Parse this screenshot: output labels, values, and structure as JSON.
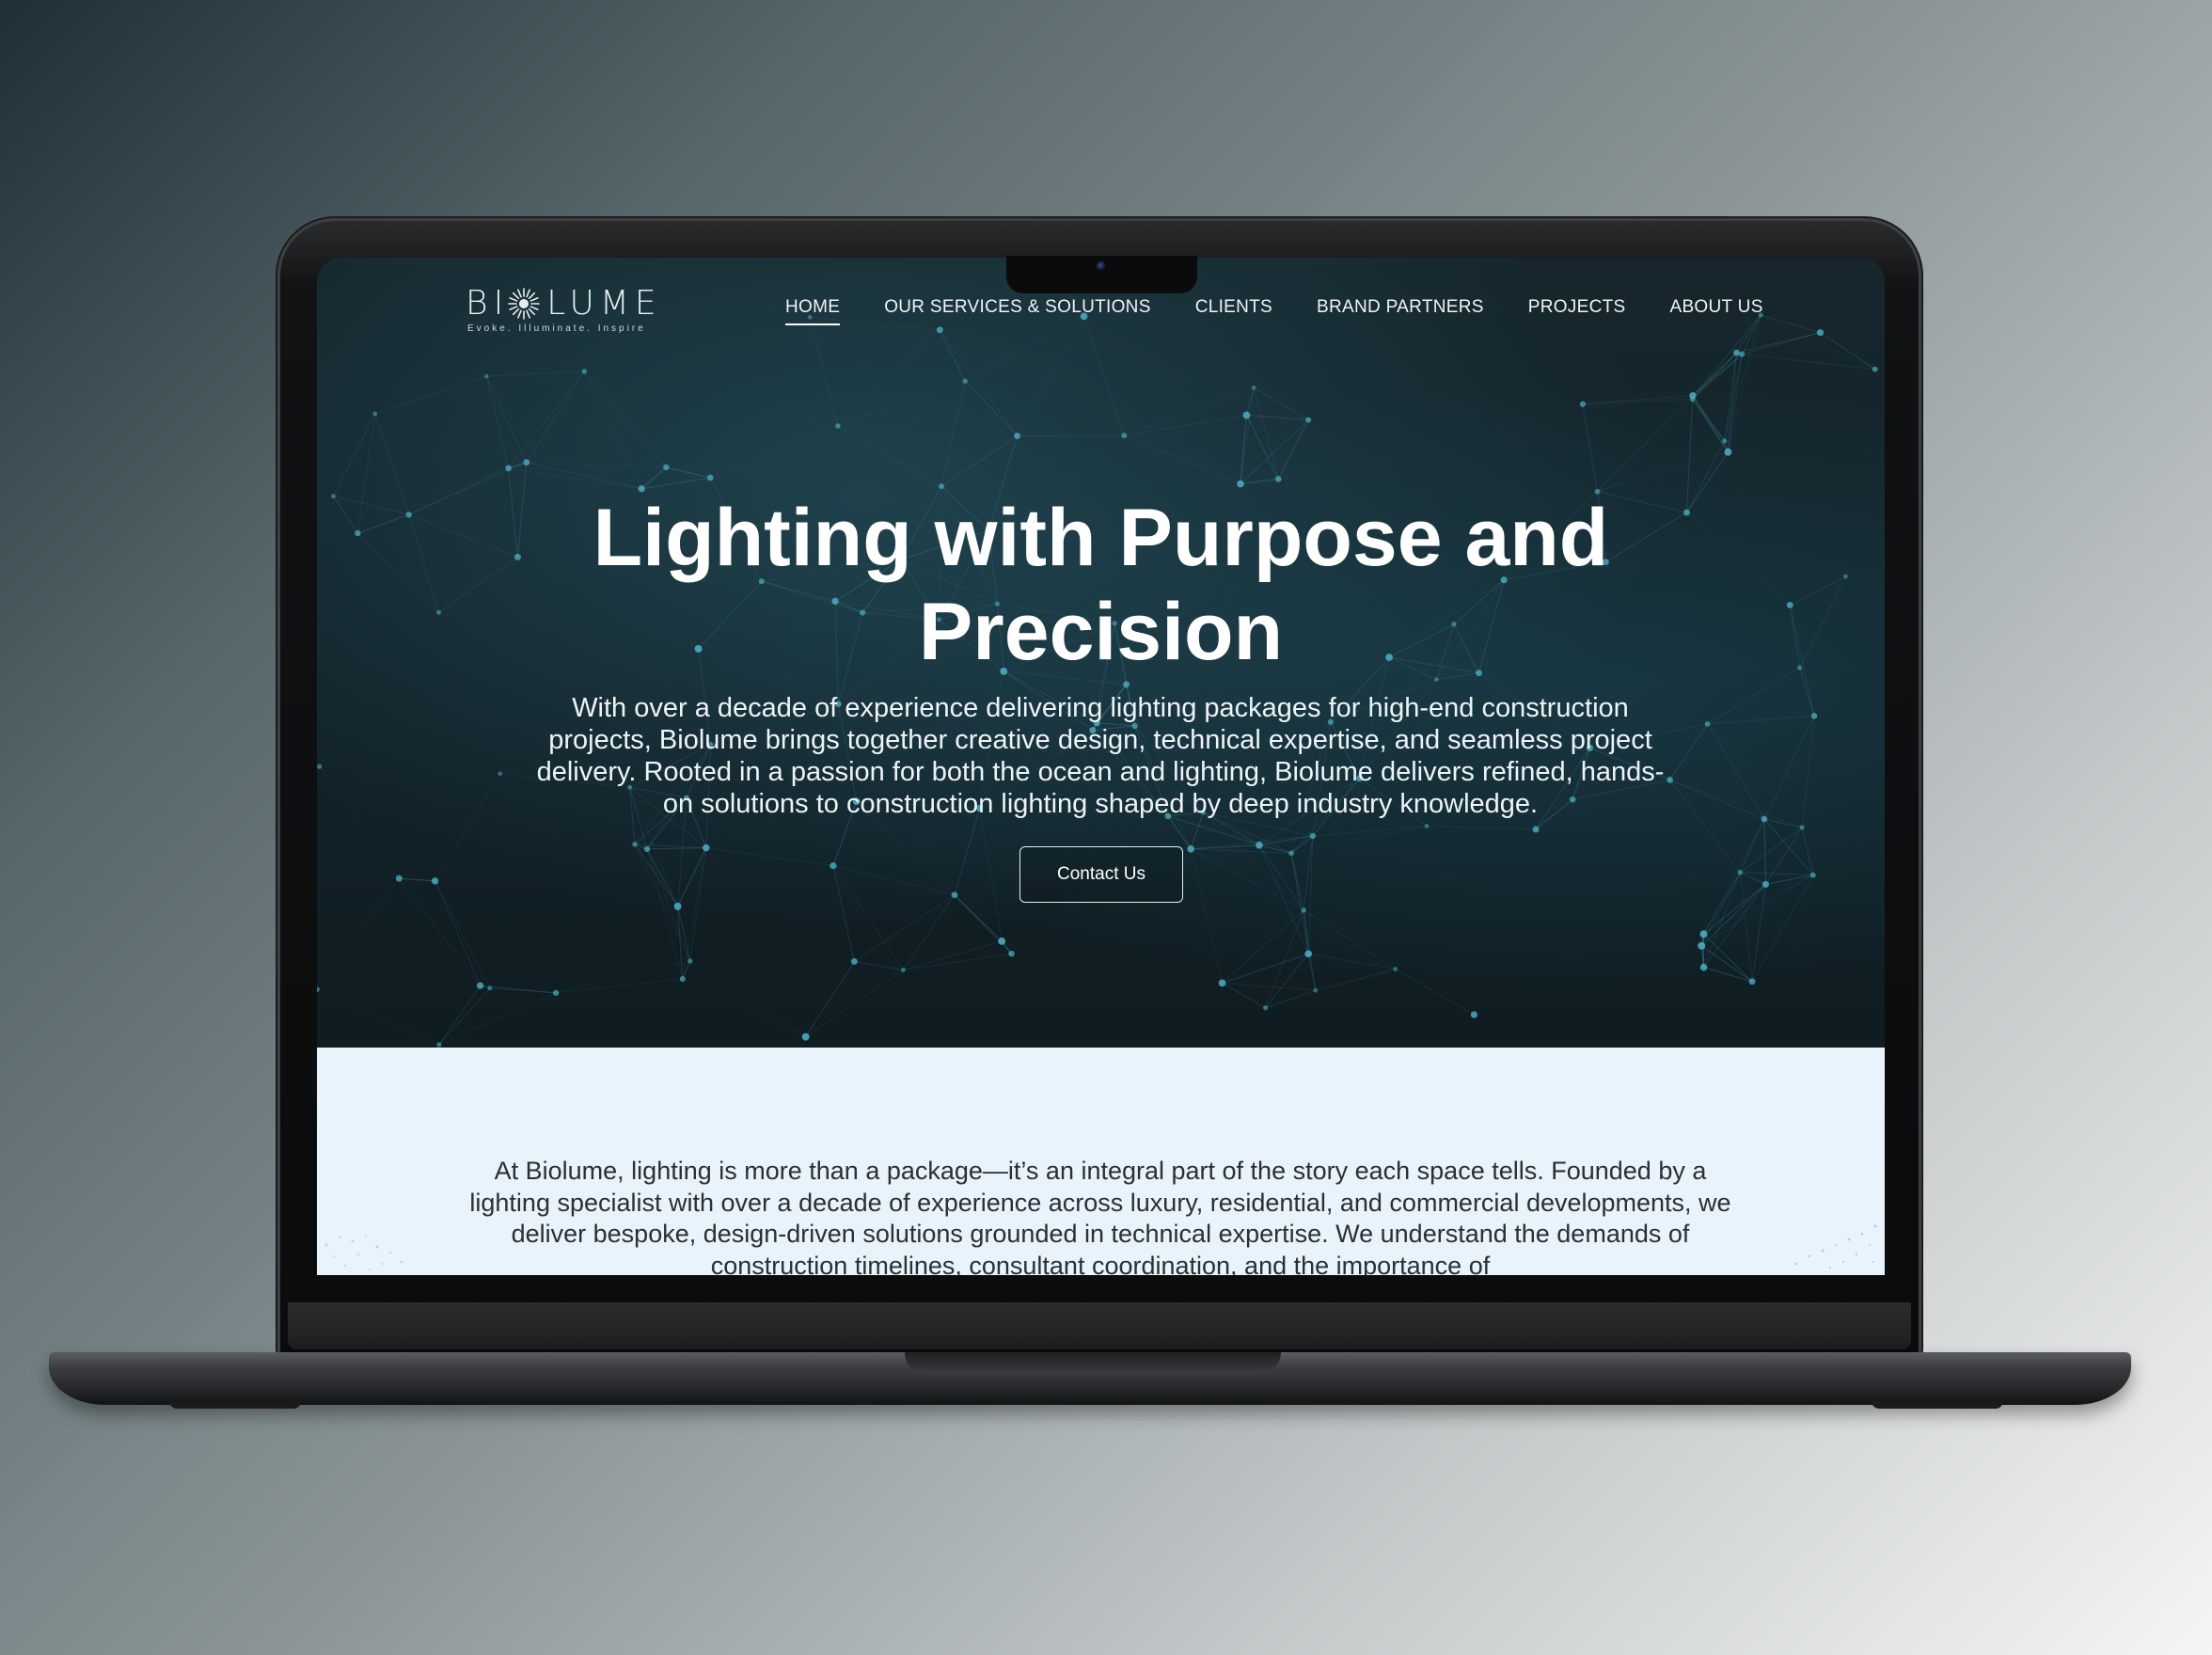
{
  "brand": {
    "name": "BIOLUME",
    "logo_left": "BI",
    "logo_right": "LUME",
    "tagline": "Evoke. Illuminate. Inspire"
  },
  "nav": {
    "items": [
      {
        "label": "HOME",
        "active": true
      },
      {
        "label": "OUR SERVICES & SOLUTIONS",
        "active": false
      },
      {
        "label": "CLIENTS",
        "active": false
      },
      {
        "label": "BRAND PARTNERS",
        "active": false
      },
      {
        "label": "PROJECTS",
        "active": false
      },
      {
        "label": "ABOUT US",
        "active": false
      }
    ]
  },
  "hero": {
    "headline_line1": "Lighting with Purpose and",
    "headline_line2": "Precision",
    "subtext": "With over a decade of experience delivering lighting packages for high-end construction projects, Biolume brings together creative design, technical expertise, and seamless project delivery. Rooted in a passion for both the ocean and lighting, Biolume delivers refined, hands-on solutions to construction lighting shaped by deep industry knowledge.",
    "cta_label": "Contact Us"
  },
  "about": {
    "text": "At Biolume, lighting is more than a package—it’s an integral part of the story each space tells. Founded by a lighting specialist with over a decade of experience across luxury, residential, and commercial developments, we deliver bespoke, design-driven solutions grounded in technical expertise. We understand the demands of construction timelines, consultant coordination, and the importance of"
  },
  "colors": {
    "hero_bg": "#13232a",
    "network_line": "#4fb3c8",
    "about_bg": "#e8f3fc",
    "text_light": "#ffffff",
    "text_dark": "#2a3033"
  }
}
